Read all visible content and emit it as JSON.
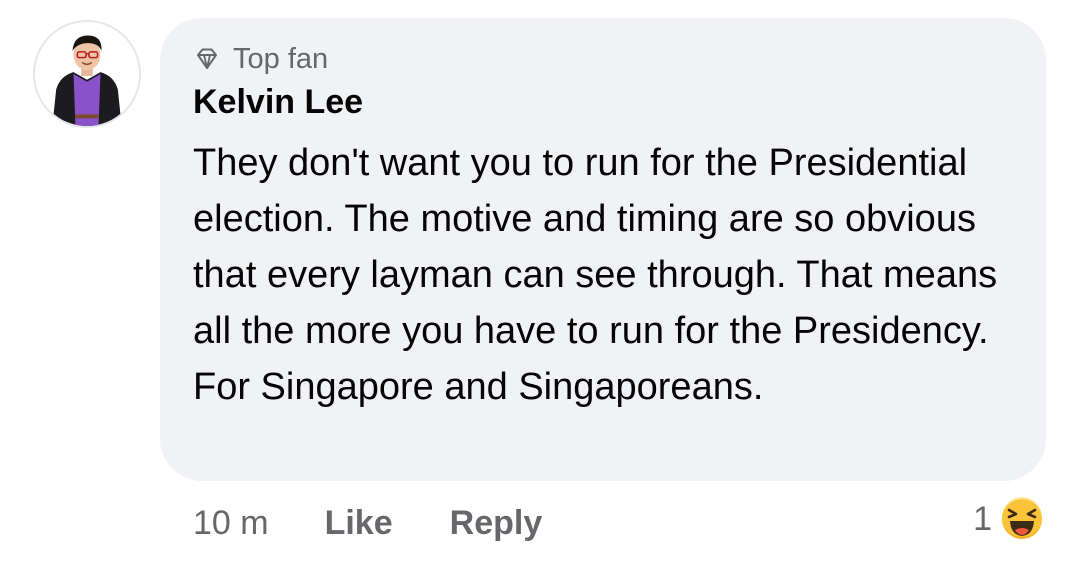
{
  "comment": {
    "badge": {
      "icon": "diamond-icon",
      "label": "Top fan"
    },
    "author": "Kelvin Lee",
    "text": "They don't want you to run for the Presidential election. The motive and timing are so obvious that every layman can see through. That means all the more you have to run for the Presidency. For Singapore and Singaporeans.",
    "avatar_icon": "profile-photo"
  },
  "actions": {
    "timestamp": "10 m",
    "like_label": "Like",
    "reply_label": "Reply"
  },
  "reactions": {
    "count": "1",
    "emoji": "haha-reaction-icon"
  },
  "colors": {
    "bubble_bg": "#f0f2f5",
    "secondary_text": "#65676b",
    "primary_text": "#050505",
    "reaction_yellow": "#f7b125"
  }
}
